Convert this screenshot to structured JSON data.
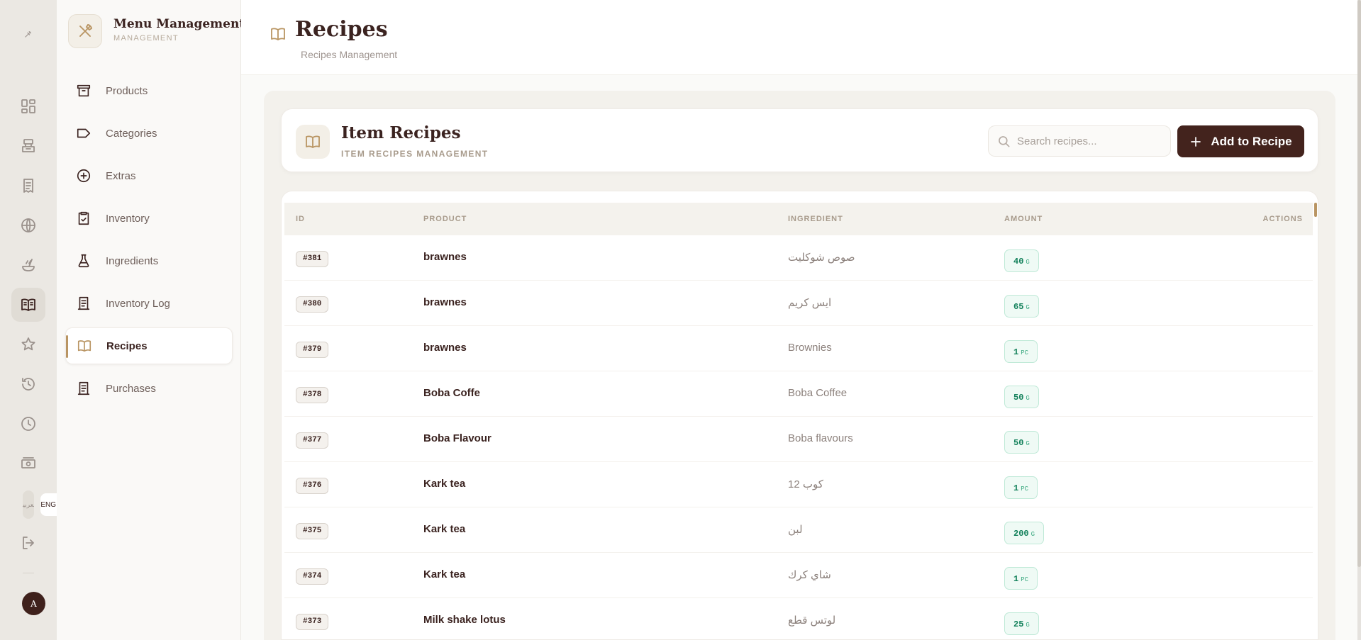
{
  "rail": {
    "icons": [
      "brand-icon",
      "dashboard-icon",
      "cashier-icon",
      "orders-icon",
      "globe-icon",
      "cooking-icon",
      "menu-book-icon",
      "star-icon",
      "history-icon",
      "clock-icon",
      "cash-icon"
    ],
    "lang_ar": "العربية",
    "lang_en": "ENG",
    "avatar": "A"
  },
  "sidebar": {
    "title": "Menu Management",
    "subtitle": "MANAGEMENT",
    "items": [
      {
        "label": "Products",
        "icon": "archive-icon"
      },
      {
        "label": "Categories",
        "icon": "tag-icon"
      },
      {
        "label": "Extras",
        "icon": "plus-circle-icon"
      },
      {
        "label": "Inventory",
        "icon": "clipboard-check-icon"
      },
      {
        "label": "Ingredients",
        "icon": "flask-icon"
      },
      {
        "label": "Inventory Log",
        "icon": "receipt-icon"
      },
      {
        "label": "Recipes",
        "icon": "book-open-icon"
      },
      {
        "label": "Purchases",
        "icon": "receipt-icon"
      }
    ],
    "active": "Recipes"
  },
  "header": {
    "title": "Recipes",
    "subtitle": "Recipes Management"
  },
  "card": {
    "title": "Item Recipes",
    "subtitle": "ITEM RECIPES MANAGEMENT",
    "search_placeholder": "Search recipes...",
    "add_label": "Add to Recipe"
  },
  "table": {
    "headers": {
      "id": "ID",
      "product": "PRODUCT",
      "ingredient": "INGREDIENT",
      "amount": "AMOUNT",
      "actions": "ACTIONS"
    },
    "rows": [
      {
        "id": "#381",
        "product": "brawnes",
        "ingredient": "صوص شوكليت",
        "amount": "40",
        "unit": "G"
      },
      {
        "id": "#380",
        "product": "brawnes",
        "ingredient": "ايس كريم",
        "amount": "65",
        "unit": "G"
      },
      {
        "id": "#379",
        "product": "brawnes",
        "ingredient": "Brownies",
        "amount": "1",
        "unit": "PC"
      },
      {
        "id": "#378",
        "product": "Boba Coffe",
        "ingredient": "Boba Coffee",
        "amount": "50",
        "unit": "G"
      },
      {
        "id": "#377",
        "product": "Boba Flavour",
        "ingredient": "Boba flavours",
        "amount": "50",
        "unit": "G"
      },
      {
        "id": "#376",
        "product": "Kark tea",
        "ingredient": "كوب 12",
        "amount": "1",
        "unit": "PC"
      },
      {
        "id": "#375",
        "product": "Kark tea",
        "ingredient": "لبن",
        "amount": "200",
        "unit": "G"
      },
      {
        "id": "#374",
        "product": "Kark tea",
        "ingredient": "شاي كرك",
        "amount": "1",
        "unit": "PC"
      },
      {
        "id": "#373",
        "product": "Milk shake lotus",
        "ingredient": "لوتس قطع",
        "amount": "25",
        "unit": "G"
      }
    ]
  },
  "colors": {
    "brand": "#43231d",
    "accent": "#b99563",
    "amount_text": "#12805a"
  }
}
